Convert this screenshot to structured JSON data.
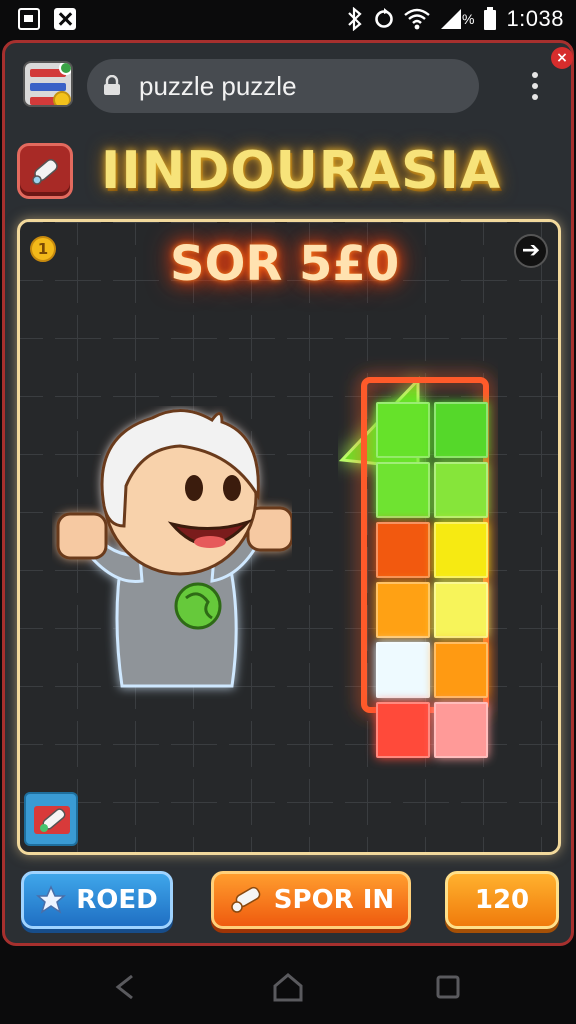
{
  "status_bar": {
    "time": "1:038",
    "battery_percent_icon": "%",
    "icons": [
      "tv-icon",
      "close-box-icon",
      "bluetooth-icon",
      "sync-icon",
      "wifi-icon",
      "signal-icon",
      "battery-icon"
    ]
  },
  "browser": {
    "url": "puzzle puzzle",
    "close_badge": "×"
  },
  "game": {
    "title": "IINDOURASIA",
    "score_label": "SOR 5£0",
    "coin_count": "1",
    "arrow": "➔",
    "cells": [
      {
        "row": 0,
        "col": 0,
        "color": "#66e22a"
      },
      {
        "row": 0,
        "col": 1,
        "color": "#55d82a"
      },
      {
        "row": 1,
        "col": 0,
        "color": "#6fe331"
      },
      {
        "row": 1,
        "col": 1,
        "color": "#86e53a"
      },
      {
        "row": 2,
        "col": 0,
        "color": "#f2590f"
      },
      {
        "row": 2,
        "col": 1,
        "color": "#f6ea12"
      },
      {
        "row": 3,
        "col": 0,
        "color": "#ffa114"
      },
      {
        "row": 3,
        "col": 1,
        "color": "#f7f45a"
      },
      {
        "row": 4,
        "col": 0,
        "color": "#eefaff"
      },
      {
        "row": 4,
        "col": 1,
        "color": "#ff9a12"
      },
      {
        "row": 5,
        "col": 0,
        "color": "#ff4a3a"
      },
      {
        "row": 5,
        "col": 1,
        "color": "#ff9a98"
      }
    ]
  },
  "buttons": {
    "roed": "ROED",
    "spor_in": "SPOR IN",
    "count": "120"
  },
  "nav": [
    "back-icon",
    "home-icon",
    "recents-icon"
  ],
  "colors": {
    "accent_red": "#a6302e",
    "title_gold": "#f7e37a",
    "board_border": "#f2d99c"
  }
}
